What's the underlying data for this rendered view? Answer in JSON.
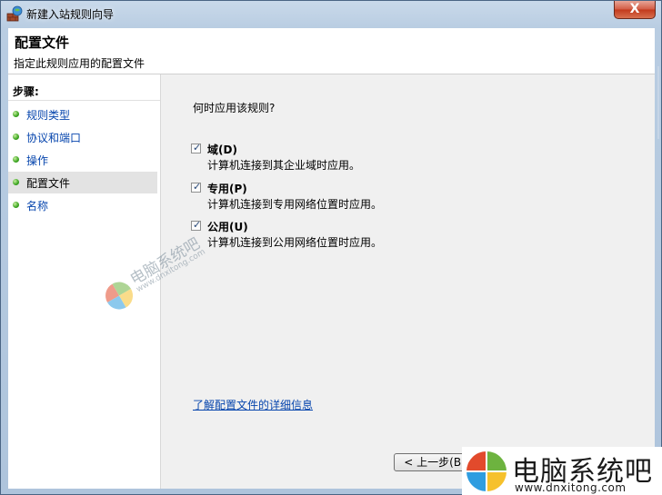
{
  "window": {
    "title": "新建入站规则向导",
    "close_glyph": "X"
  },
  "header": {
    "title": "配置文件",
    "subtitle": "指定此规则应用的配置文件"
  },
  "steps": {
    "label": "步骤:",
    "items": [
      {
        "label": "规则类型",
        "active": false
      },
      {
        "label": "协议和端口",
        "active": false
      },
      {
        "label": "操作",
        "active": false
      },
      {
        "label": "配置文件",
        "active": true
      },
      {
        "label": "名称",
        "active": false
      }
    ]
  },
  "main": {
    "question": "何时应用该规则?",
    "options": [
      {
        "label": "域(D)",
        "description": "计算机连接到其企业域时应用。",
        "checked": true
      },
      {
        "label": "专用(P)",
        "description": "计算机连接到专用网络位置时应用。",
        "checked": true
      },
      {
        "label": "公用(U)",
        "description": "计算机连接到公用网络位置时应用。",
        "checked": true
      }
    ],
    "learn_more_link": "了解配置文件的详细信息"
  },
  "footer": {
    "back_button": "< 上一步(B)"
  },
  "watermark": {
    "brand_cn": "电脑系统吧",
    "brand_url": "www.dnxitong.com",
    "diag_cn": "电脑系统吧",
    "diag_url": "www.dnxitong.com"
  },
  "icons": {
    "app": "firewall-wizard-icon",
    "step_bullet": "green-dot-icon",
    "checkbox": "checkmark-icon",
    "brand_logo": "windows-logo-icon"
  },
  "colors": {
    "link": "#0645ad",
    "titlebar": "#b9cde2",
    "close_button": "#c2391c",
    "step_bullet": "#3aa420",
    "active_step_bg": "#e3e3e3"
  }
}
